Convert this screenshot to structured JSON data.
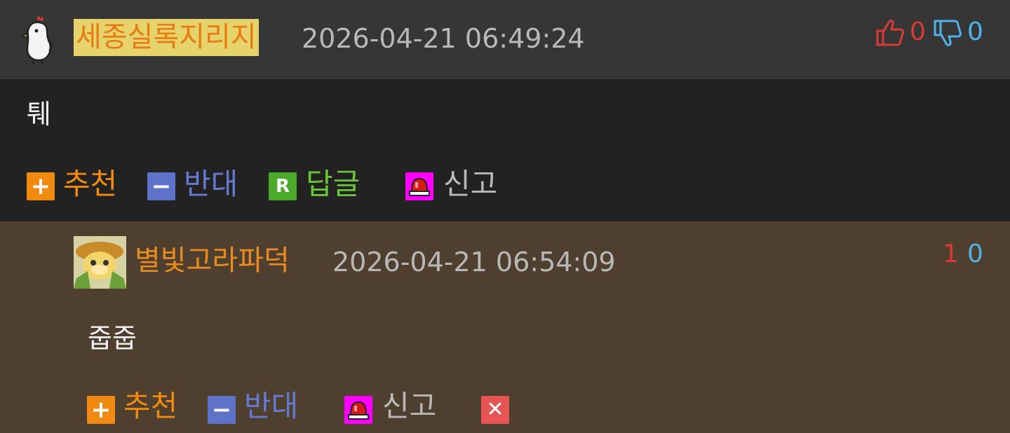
{
  "comment": {
    "author": "세종실록지리지",
    "timestamp": "2026-04-21 06:49:24",
    "votes": {
      "up": "0",
      "down": "0"
    },
    "text": "퉤",
    "actions": {
      "recommend": "추천",
      "oppose": "반대",
      "reply": "답글",
      "report": "신고"
    },
    "icons": [
      "chicken-avatar",
      "thumbs-up-icon",
      "thumbs-down-icon",
      "plus-icon",
      "minus-icon",
      "reply-r-icon",
      "siren-icon"
    ]
  },
  "reply": {
    "author": "별빛고라파덕",
    "timestamp": "2026-04-21 06:54:09",
    "votes": {
      "up": "1",
      "down": "0"
    },
    "text": "줍줍",
    "actions": {
      "recommend": "추천",
      "oppose": "반대",
      "report": "신고"
    },
    "icons": [
      "frog-avatar",
      "plus-icon",
      "minus-icon",
      "siren-icon",
      "delete-x-icon"
    ]
  },
  "colors": {
    "header_bg": "#363636",
    "body_bg": "#222222",
    "reply_bg": "#4f3f2f",
    "author_highlight": "#e6d36b",
    "author_text": "#e77d12",
    "up_vote": "#d93a37",
    "down_vote": "#4fb3e9",
    "recommend": "#f08a10",
    "oppose": "#6579d0",
    "reply_green": "#69c637",
    "report_magenta": "#ff00ff",
    "delete_red": "#e85454"
  }
}
